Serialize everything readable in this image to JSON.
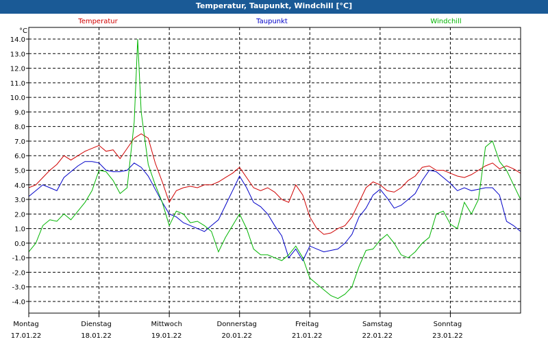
{
  "window": {
    "title": "Temperatur, Taupunkt, Windchill [°C]"
  },
  "chart_data": {
    "type": "line",
    "title": "Temperatur, Taupunkt, Windchill [°C]",
    "ylabel": "°C",
    "ylim": [
      -4.8,
      14.8
    ],
    "y_ticks": [
      "14.0",
      "13.0",
      "12.0",
      "11.0",
      "10.0",
      "9.0",
      "8.0",
      "7.0",
      "6.0",
      "5.0",
      "4.0",
      "3.0",
      "2.0",
      "1.0",
      "0.0",
      "-1.0",
      "-2.0",
      "-3.0",
      "-4.0"
    ],
    "x_range": [
      0,
      7
    ],
    "x_unit": "days since Montag 17.01.22 00:00",
    "day_labels": [
      {
        "weekday": "Montag",
        "date": "17.01.22"
      },
      {
        "weekday": "Dienstag",
        "date": "18.01.22"
      },
      {
        "weekday": "Mittwoch",
        "date": "19.01.22"
      },
      {
        "weekday": "Donnerstag",
        "date": "20.01.22"
      },
      {
        "weekday": "Freitag",
        "date": "21.01.22"
      },
      {
        "weekday": "Samstag",
        "date": "22.01.22"
      },
      {
        "weekday": "Sonntag",
        "date": "23.01.22"
      }
    ],
    "grid": true,
    "legend_position": "top",
    "series": [
      {
        "name": "Temperatur",
        "color": "#d00000",
        "points": [
          [
            0,
            3.8
          ],
          [
            0.1,
            4.0
          ],
          [
            0.2,
            4.5
          ],
          [
            0.3,
            5.0
          ],
          [
            0.4,
            5.4
          ],
          [
            0.5,
            6.0
          ],
          [
            0.6,
            5.7
          ],
          [
            0.7,
            6.0
          ],
          [
            0.8,
            6.3
          ],
          [
            0.9,
            6.5
          ],
          [
            1.0,
            6.7
          ],
          [
            1.1,
            6.3
          ],
          [
            1.2,
            6.4
          ],
          [
            1.3,
            5.8
          ],
          [
            1.4,
            6.5
          ],
          [
            1.5,
            7.2
          ],
          [
            1.6,
            7.5
          ],
          [
            1.7,
            7.2
          ],
          [
            1.8,
            5.5
          ],
          [
            1.9,
            4.2
          ],
          [
            2.0,
            2.8
          ],
          [
            2.1,
            3.6
          ],
          [
            2.2,
            3.8
          ],
          [
            2.3,
            3.9
          ],
          [
            2.4,
            3.8
          ],
          [
            2.5,
            4.0
          ],
          [
            2.6,
            4.0
          ],
          [
            2.7,
            4.2
          ],
          [
            2.8,
            4.5
          ],
          [
            2.9,
            4.8
          ],
          [
            3.0,
            5.2
          ],
          [
            3.1,
            4.5
          ],
          [
            3.2,
            3.8
          ],
          [
            3.3,
            3.6
          ],
          [
            3.4,
            3.8
          ],
          [
            3.5,
            3.5
          ],
          [
            3.6,
            3.0
          ],
          [
            3.7,
            2.8
          ],
          [
            3.8,
            4.0
          ],
          [
            3.9,
            3.3
          ],
          [
            4.0,
            1.8
          ],
          [
            4.1,
            1.0
          ],
          [
            4.2,
            0.6
          ],
          [
            4.3,
            0.7
          ],
          [
            4.4,
            1.0
          ],
          [
            4.5,
            1.2
          ],
          [
            4.6,
            1.8
          ],
          [
            4.7,
            2.8
          ],
          [
            4.8,
            3.8
          ],
          [
            4.9,
            4.2
          ],
          [
            5.0,
            4.0
          ],
          [
            5.1,
            3.6
          ],
          [
            5.2,
            3.5
          ],
          [
            5.3,
            3.8
          ],
          [
            5.4,
            4.3
          ],
          [
            5.5,
            4.6
          ],
          [
            5.6,
            5.2
          ],
          [
            5.7,
            5.3
          ],
          [
            5.8,
            5.0
          ],
          [
            5.9,
            5.0
          ],
          [
            6.0,
            4.8
          ],
          [
            6.1,
            4.6
          ],
          [
            6.2,
            4.5
          ],
          [
            6.3,
            4.7
          ],
          [
            6.4,
            5.0
          ],
          [
            6.5,
            5.3
          ],
          [
            6.6,
            5.5
          ],
          [
            6.7,
            5.1
          ],
          [
            6.8,
            5.3
          ],
          [
            6.9,
            5.1
          ],
          [
            7.0,
            4.8
          ]
        ]
      },
      {
        "name": "Taupunkt",
        "color": "#0000c8",
        "points": [
          [
            0,
            3.2
          ],
          [
            0.1,
            3.6
          ],
          [
            0.2,
            4.0
          ],
          [
            0.3,
            3.8
          ],
          [
            0.4,
            3.6
          ],
          [
            0.5,
            4.5
          ],
          [
            0.6,
            4.9
          ],
          [
            0.7,
            5.3
          ],
          [
            0.8,
            5.6
          ],
          [
            0.9,
            5.6
          ],
          [
            1.0,
            5.5
          ],
          [
            1.1,
            5.0
          ],
          [
            1.2,
            4.9
          ],
          [
            1.3,
            4.9
          ],
          [
            1.4,
            5.0
          ],
          [
            1.5,
            5.5
          ],
          [
            1.6,
            5.2
          ],
          [
            1.7,
            4.6
          ],
          [
            1.8,
            3.7
          ],
          [
            1.9,
            2.8
          ],
          [
            2.0,
            2.0
          ],
          [
            2.1,
            1.8
          ],
          [
            2.2,
            1.4
          ],
          [
            2.3,
            1.2
          ],
          [
            2.4,
            1.0
          ],
          [
            2.5,
            0.8
          ],
          [
            2.6,
            1.2
          ],
          [
            2.7,
            1.6
          ],
          [
            2.8,
            2.6
          ],
          [
            2.9,
            3.6
          ],
          [
            3.0,
            4.6
          ],
          [
            3.1,
            3.8
          ],
          [
            3.2,
            2.8
          ],
          [
            3.3,
            2.5
          ],
          [
            3.4,
            2.0
          ],
          [
            3.5,
            1.2
          ],
          [
            3.6,
            0.5
          ],
          [
            3.7,
            -1.0
          ],
          [
            3.8,
            -0.4
          ],
          [
            3.9,
            -1.2
          ],
          [
            4.0,
            -0.2
          ],
          [
            4.1,
            -0.4
          ],
          [
            4.2,
            -0.6
          ],
          [
            4.3,
            -0.5
          ],
          [
            4.4,
            -0.4
          ],
          [
            4.5,
            0.0
          ],
          [
            4.6,
            0.6
          ],
          [
            4.7,
            1.8
          ],
          [
            4.8,
            2.4
          ],
          [
            4.9,
            3.3
          ],
          [
            5.0,
            3.7
          ],
          [
            5.1,
            3.1
          ],
          [
            5.2,
            2.4
          ],
          [
            5.3,
            2.6
          ],
          [
            5.4,
            3.0
          ],
          [
            5.5,
            3.4
          ],
          [
            5.6,
            4.3
          ],
          [
            5.7,
            5.0
          ],
          [
            5.8,
            4.9
          ],
          [
            5.9,
            4.5
          ],
          [
            6.0,
            4.1
          ],
          [
            6.1,
            3.6
          ],
          [
            6.2,
            3.8
          ],
          [
            6.3,
            3.6
          ],
          [
            6.4,
            3.7
          ],
          [
            6.5,
            3.8
          ],
          [
            6.6,
            3.8
          ],
          [
            6.7,
            3.3
          ],
          [
            6.8,
            1.5
          ],
          [
            6.9,
            1.2
          ],
          [
            7.0,
            0.8
          ]
        ]
      },
      {
        "name": "Windchill",
        "color": "#00b400",
        "points": [
          [
            0,
            -0.6
          ],
          [
            0.1,
            0.0
          ],
          [
            0.2,
            1.2
          ],
          [
            0.3,
            1.6
          ],
          [
            0.4,
            1.5
          ],
          [
            0.5,
            2.0
          ],
          [
            0.6,
            1.6
          ],
          [
            0.7,
            2.2
          ],
          [
            0.8,
            2.8
          ],
          [
            0.9,
            3.6
          ],
          [
            1.0,
            5.0
          ],
          [
            1.1,
            4.9
          ],
          [
            1.2,
            4.3
          ],
          [
            1.3,
            3.4
          ],
          [
            1.4,
            3.8
          ],
          [
            1.5,
            8.3
          ],
          [
            1.55,
            14.0
          ],
          [
            1.6,
            9.0
          ],
          [
            1.7,
            5.4
          ],
          [
            1.8,
            4.0
          ],
          [
            1.9,
            2.8
          ],
          [
            2.0,
            1.2
          ],
          [
            2.1,
            2.2
          ],
          [
            2.2,
            2.0
          ],
          [
            2.3,
            1.4
          ],
          [
            2.4,
            1.5
          ],
          [
            2.5,
            1.2
          ],
          [
            2.6,
            0.8
          ],
          [
            2.7,
            -0.6
          ],
          [
            2.8,
            0.4
          ],
          [
            2.9,
            1.2
          ],
          [
            3.0,
            2.0
          ],
          [
            3.1,
            1.0
          ],
          [
            3.2,
            -0.4
          ],
          [
            3.3,
            -0.8
          ],
          [
            3.4,
            -0.8
          ],
          [
            3.5,
            -1.0
          ],
          [
            3.6,
            -1.2
          ],
          [
            3.7,
            -0.8
          ],
          [
            3.8,
            -0.2
          ],
          [
            3.9,
            -1.0
          ],
          [
            4.0,
            -2.4
          ],
          [
            4.1,
            -2.8
          ],
          [
            4.2,
            -3.2
          ],
          [
            4.3,
            -3.6
          ],
          [
            4.4,
            -3.8
          ],
          [
            4.5,
            -3.5
          ],
          [
            4.6,
            -3.0
          ],
          [
            4.7,
            -1.6
          ],
          [
            4.8,
            -0.5
          ],
          [
            4.9,
            -0.4
          ],
          [
            5.0,
            0.2
          ],
          [
            5.1,
            0.6
          ],
          [
            5.2,
            0.0
          ],
          [
            5.3,
            -0.8
          ],
          [
            5.4,
            -1.0
          ],
          [
            5.5,
            -0.6
          ],
          [
            5.6,
            0.0
          ],
          [
            5.7,
            0.4
          ],
          [
            5.8,
            2.0
          ],
          [
            5.9,
            2.2
          ],
          [
            6.0,
            1.3
          ],
          [
            6.1,
            1.0
          ],
          [
            6.2,
            2.8
          ],
          [
            6.3,
            2.0
          ],
          [
            6.4,
            3.0
          ],
          [
            6.5,
            6.6
          ],
          [
            6.6,
            7.0
          ],
          [
            6.7,
            5.6
          ],
          [
            6.8,
            5.0
          ],
          [
            6.9,
            4.0
          ],
          [
            7.0,
            3.0
          ]
        ]
      }
    ]
  }
}
